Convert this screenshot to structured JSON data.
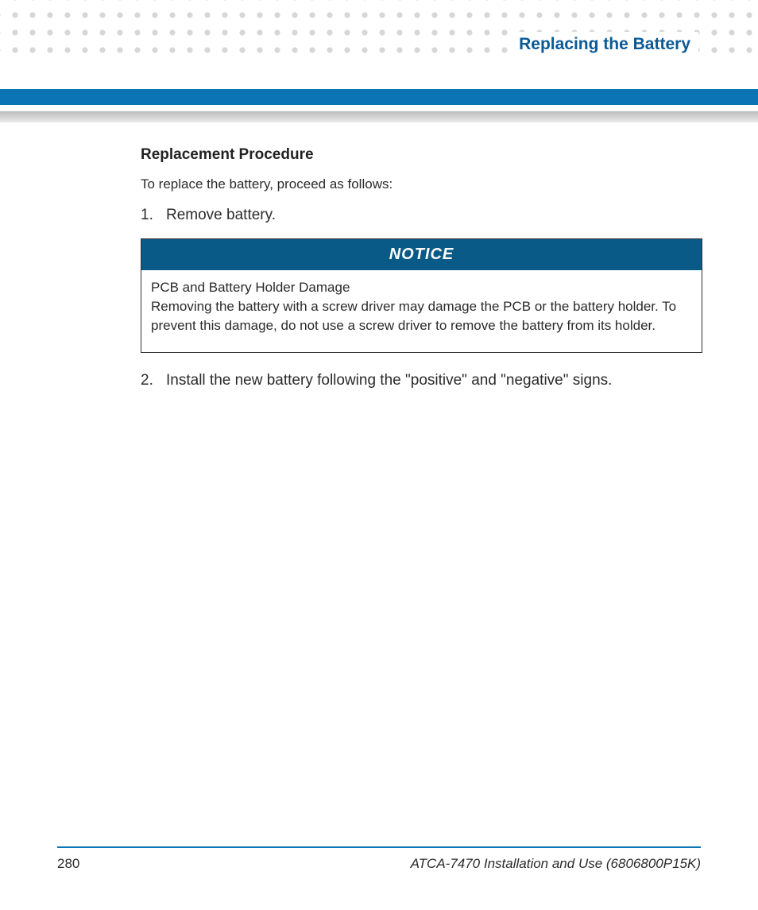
{
  "header": {
    "title": "Replacing the Battery"
  },
  "section": {
    "heading": "Replacement Procedure",
    "intro": "To replace the battery, proceed as follows:",
    "steps": [
      {
        "num": "1.",
        "text": "Remove battery."
      },
      {
        "num": "2.",
        "text": "Install the new battery following the \"positive\" and \"negative\" signs."
      }
    ]
  },
  "notice": {
    "label": "NOTICE",
    "title": "PCB and Battery Holder Damage",
    "body": "Removing the battery with a screw driver may damage the PCB or the battery holder. To prevent this damage, do not use a screw driver to remove the battery from its holder."
  },
  "footer": {
    "page": "280",
    "doc": "ATCA-7470 Installation and Use (6806800P15K)"
  }
}
